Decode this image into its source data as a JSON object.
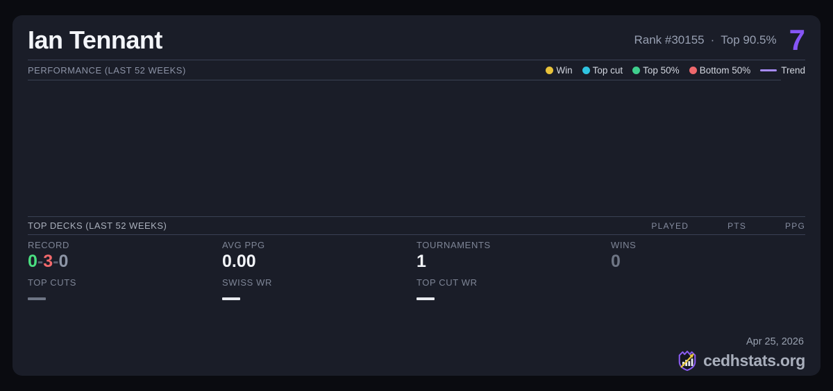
{
  "header": {
    "player_name": "Ian Tennant",
    "rank_label": "Rank #30155",
    "dot_separator": "·",
    "percentile_label": "Top 90.5%",
    "score": "7"
  },
  "performance": {
    "section_title": "PERFORMANCE (LAST 52 WEEKS)",
    "legend": [
      {
        "label": "Win",
        "color": "#e8c23a",
        "marker": "dot"
      },
      {
        "label": "Top cut",
        "color": "#2fc4e0",
        "marker": "dot"
      },
      {
        "label": "Top 50%",
        "color": "#3fcf8d",
        "marker": "dot"
      },
      {
        "label": "Bottom 50%",
        "color": "#ee686c",
        "marker": "dot"
      },
      {
        "label": "Trend",
        "color": "#a78bfa",
        "marker": "line"
      }
    ],
    "chart": {
      "type": "scatter",
      "points": [],
      "note_visible": false
    }
  },
  "top_decks": {
    "section_title": "TOP DECKS (LAST 52 WEEKS)",
    "columns": [
      "PLAYED",
      "PTS",
      "PPG"
    ],
    "rows": []
  },
  "stats": {
    "record": {
      "label": "RECORD",
      "wins": "0",
      "sep": "-",
      "losses": "3",
      "draws": "0"
    },
    "avg_ppg": {
      "label": "AVG PPG",
      "value": "0.00"
    },
    "tournaments": {
      "label": "TOURNAMENTS",
      "value": "1"
    },
    "wins": {
      "label": "WINS",
      "value": "0"
    },
    "top_cuts": {
      "label": "TOP CUTS",
      "placeholder": "dash",
      "dash_color": "#6e7585"
    },
    "swiss_wr": {
      "label": "SWISS WR",
      "placeholder": "dash",
      "dash_color": "#e8eaef"
    },
    "top_cut_wr": {
      "label": "TOP CUT WR",
      "placeholder": "dash",
      "dash_color": "#e8eaef"
    }
  },
  "footer": {
    "date": "Apr 25, 2026",
    "brand": "cedhstats.org"
  },
  "colors": {
    "page_bg": "#0a0b10",
    "card_bg": "#1a1d28",
    "divider": "#3a4154",
    "accent_purple": "#8655f5",
    "win_green": "#4ade80",
    "loss_red": "#f2696c",
    "logo_purple": "#8a5cf0",
    "logo_gold": "#e9c83c"
  }
}
